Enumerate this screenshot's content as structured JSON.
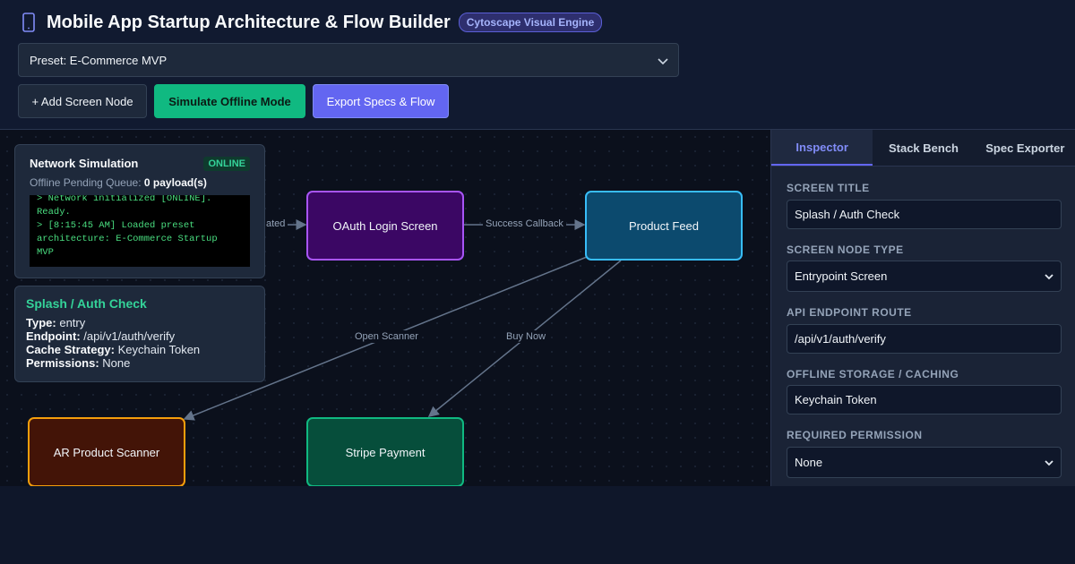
{
  "header": {
    "title": "Mobile App Startup Architecture & Flow Builder",
    "badge": "Cytoscape Visual Engine",
    "preset_value": "Preset: E-Commerce MVP",
    "buttons": {
      "add": "+ Add Screen Node",
      "offline": "Simulate Offline Mode",
      "export": "Export Specs & Flow"
    }
  },
  "canvas": {
    "nodes": {
      "oauth": "OAuth Login Screen",
      "feed": "Product Feed",
      "ar": "AR Product Scanner",
      "stripe": "Stripe Payment"
    },
    "edges": {
      "into_oauth_partial": "ated",
      "success": "Success Callback",
      "scanner": "Open Scanner",
      "buy": "Buy Now"
    }
  },
  "network": {
    "title": "Network Simulation",
    "status": "ONLINE",
    "queue_label": "Offline Pending Queue:",
    "queue_value": "0 payload(s)",
    "log": [
      "> Network initialized [ONLINE].",
      "Ready.",
      "> [8:15:45 AM] Loaded preset",
      "architecture: E-Commerce Startup",
      "MVP"
    ]
  },
  "detail": {
    "title": "Splash / Auth Check",
    "rows": [
      {
        "label": "Type:",
        "value": "entry"
      },
      {
        "label": "Endpoint:",
        "value": "/api/v1/auth/verify"
      },
      {
        "label": "Cache Strategy:",
        "value": "Keychain Token"
      },
      {
        "label": "Permissions:",
        "value": "None"
      }
    ]
  },
  "panel": {
    "tabs": [
      "Inspector",
      "Stack Bench",
      "Spec Exporter"
    ],
    "fields": {
      "title_label": "Screen Title",
      "title_value": "Splash / Auth Check",
      "type_label": "Screen Node Type",
      "type_value": "Entrypoint Screen",
      "api_label": "API Endpoint Route",
      "api_value": "/api/v1/auth/verify",
      "storage_label": "Offline Storage / Caching",
      "storage_value": "Keychain Token",
      "perm_label": "Required Permission",
      "perm_value": "None"
    }
  },
  "colors": {
    "accent": "#6366f1",
    "success": "#10b981",
    "background": "#0f172a"
  },
  "icons": [
    "phone-icon",
    "chevron-down-icon"
  ]
}
